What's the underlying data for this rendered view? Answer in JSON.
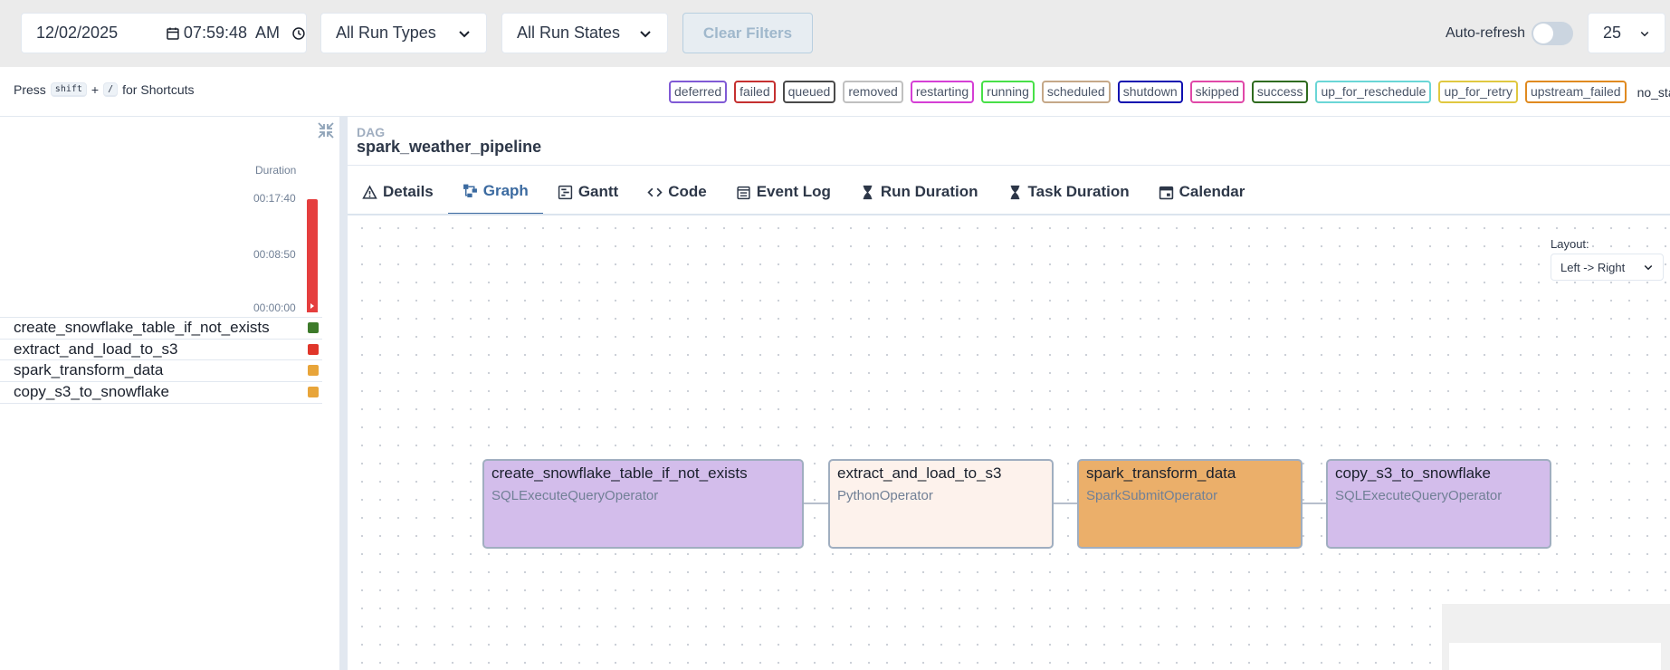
{
  "filters": {
    "date": "12/02/2025",
    "time": "07:59:48  AM",
    "run_types": "All Run Types",
    "run_states": "All Run States",
    "clear_label": "Clear Filters",
    "auto_refresh_label": "Auto-refresh",
    "auto_refresh_on": false,
    "page_size": "25"
  },
  "shortcut": {
    "press": "Press",
    "key1": "shift",
    "plus": "+",
    "key2": "/",
    "suffix": "for Shortcuts"
  },
  "legend": [
    {
      "label": "deferred",
      "color": "#805ad5"
    },
    {
      "label": "failed",
      "color": "#c53030"
    },
    {
      "label": "queued",
      "color": "#4a4a4a"
    },
    {
      "label": "removed",
      "color": "#c0c0c0"
    },
    {
      "label": "restarting",
      "color": "#d53fd5"
    },
    {
      "label": "running",
      "color": "#48e048"
    },
    {
      "label": "scheduled",
      "color": "#c5a888"
    },
    {
      "label": "shutdown",
      "color": "#1010b0"
    },
    {
      "label": "skipped",
      "color": "#e048a8"
    },
    {
      "label": "success",
      "color": "#2f6b1f"
    },
    {
      "label": "up_for_reschedule",
      "color": "#6ad6d6"
    },
    {
      "label": "up_for_retry",
      "color": "#e0c840"
    },
    {
      "label": "upstream_failed",
      "color": "#e08a20"
    }
  ],
  "legend_plain": "no_status",
  "grid": {
    "duration_label": "Duration",
    "ticks": [
      "00:17:40",
      "00:08:50",
      "00:00:00"
    ],
    "run_bar": {
      "duration": "00:17:40",
      "fraction": 1.0,
      "color": "#e53e3e"
    },
    "tasks": [
      {
        "name": "create_snowflake_table_if_not_exists",
        "color": "#3d7a2a"
      },
      {
        "name": "extract_and_load_to_s3",
        "color": "#e0362a"
      },
      {
        "name": "spark_transform_data",
        "color": "#e8a53a"
      },
      {
        "name": "copy_s3_to_snowflake",
        "color": "#e8a53a"
      }
    ]
  },
  "dag": {
    "kicker": "DAG",
    "id": "spark_weather_pipeline"
  },
  "tabs": [
    {
      "label": "Details",
      "icon": "warning-icon",
      "active": false
    },
    {
      "label": "Graph",
      "icon": "graph-icon",
      "active": true
    },
    {
      "label": "Gantt",
      "icon": "gantt-icon",
      "active": false
    },
    {
      "label": "Code",
      "icon": "code-icon",
      "active": false
    },
    {
      "label": "Event Log",
      "icon": "event-log-icon",
      "active": false
    },
    {
      "label": "Run Duration",
      "icon": "hourglass-icon",
      "active": false
    },
    {
      "label": "Task Duration",
      "icon": "hourglass-icon",
      "active": false
    },
    {
      "label": "Calendar",
      "icon": "calendar-icon",
      "active": false
    }
  ],
  "graph": {
    "layout_label": "Layout:",
    "layout_value": "Left -> Right",
    "nodes": [
      {
        "name": "create_snowflake_table_if_not_exists",
        "operator": "SQLExecuteQueryOperator",
        "fill": "#d3bdeb"
      },
      {
        "name": "extract_and_load_to_s3",
        "operator": "PythonOperator",
        "fill": "#fdf2ec"
      },
      {
        "name": "spark_transform_data",
        "operator": "SparkSubmitOperator",
        "fill": "#ebaf6a"
      },
      {
        "name": "copy_s3_to_snowflake",
        "operator": "SQLExecuteQueryOperator",
        "fill": "#d3bdeb"
      }
    ]
  }
}
